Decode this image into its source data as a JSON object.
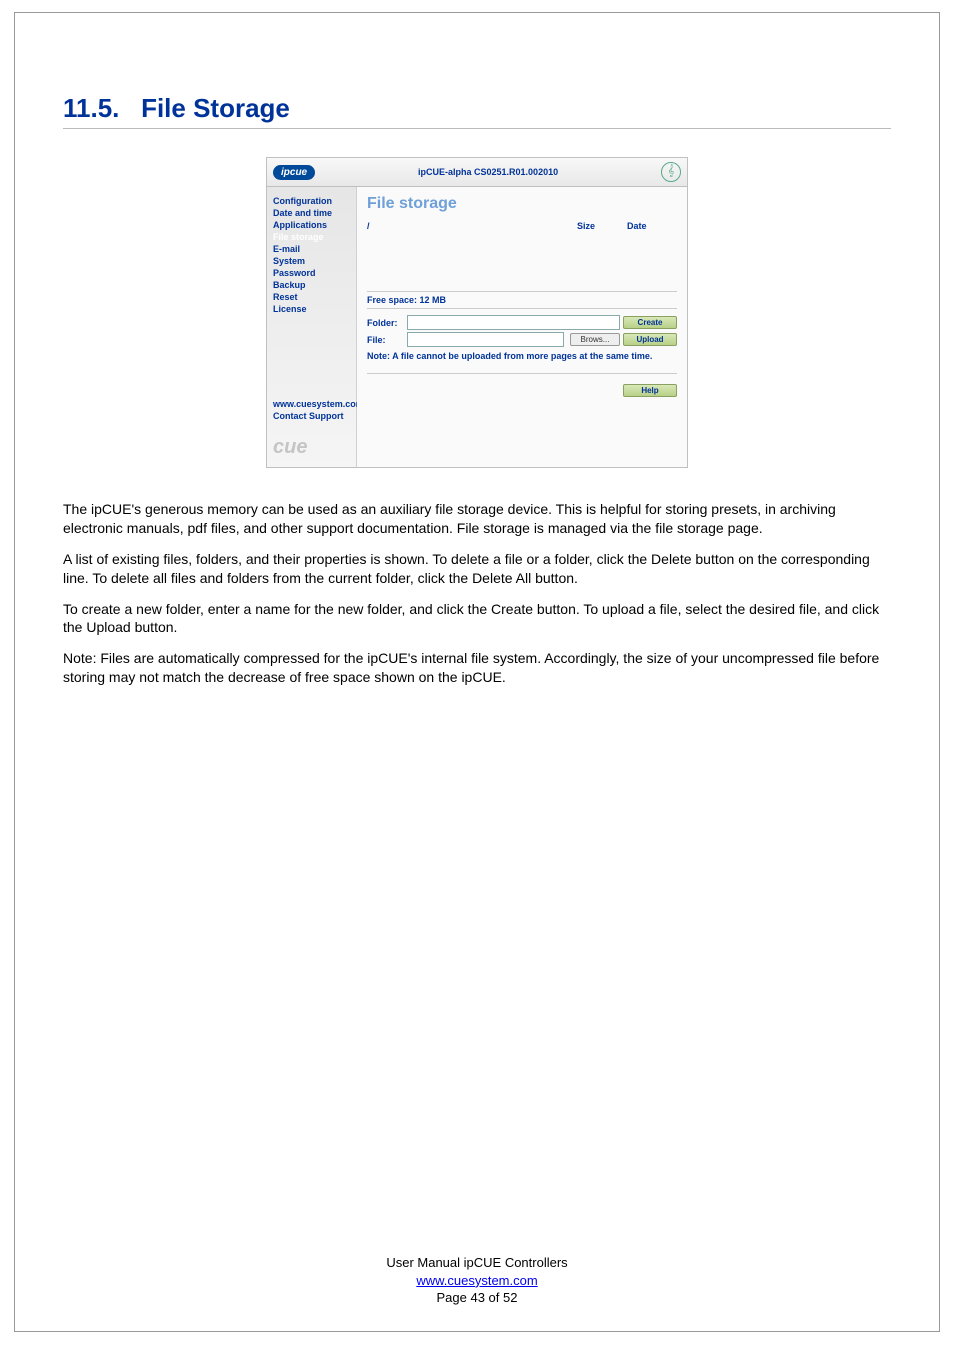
{
  "section": {
    "number": "11.5.",
    "title": "File Storage"
  },
  "app": {
    "header_logo": "ipcue",
    "header_title": "ipCUE-alpha   CS0251.R01.002010",
    "sidebar": {
      "items": [
        {
          "label": "Configuration"
        },
        {
          "label": "Date and time"
        },
        {
          "label": "Applications"
        },
        {
          "label": "File storage",
          "active": true
        },
        {
          "label": "E-mail"
        },
        {
          "label": "System"
        },
        {
          "label": "Password"
        },
        {
          "label": "Backup"
        },
        {
          "label": "Reset"
        },
        {
          "label": "License"
        }
      ],
      "links": [
        {
          "label": "www.cuesystem.com"
        },
        {
          "label": "Contact Support"
        }
      ],
      "brand": "cue"
    },
    "main": {
      "title": "File storage",
      "table": {
        "path": "/",
        "col_size": "Size",
        "col_date": "Date"
      },
      "free_space": "Free space: 12 MB",
      "folder_label": "Folder:",
      "file_label": "File:",
      "create_btn": "Create",
      "browse_btn": "Brows...",
      "upload_btn": "Upload",
      "note": "Note: A file cannot be uploaded from more pages at the same time.",
      "help_btn": "Help"
    }
  },
  "body": {
    "p1": "The ipCUE's generous memory can be used as an auxiliary file storage device. This is helpful for storing presets, in archiving electronic manuals, pdf files, and other support documentation. File storage is managed via the file storage page.",
    "p2": "A list of existing files, folders, and their properties is shown. To delete a file or a folder, click the Delete button on the corresponding line. To delete all files and folders from the current folder, click the Delete All button.",
    "p3": "To create a new folder, enter a name for the new folder, and click the Create button. To upload a file, select the desired file, and click the Upload button.",
    "p4": "Note: Files are automatically compressed for the ipCUE's internal file system. Accordingly, the size of your uncompressed file before storing may not match the decrease of free space shown on the ipCUE."
  },
  "footer": {
    "line1": "User Manual ipCUE Controllers",
    "link": "www.cuesystem.com",
    "line3": "Page 43 of 52"
  }
}
